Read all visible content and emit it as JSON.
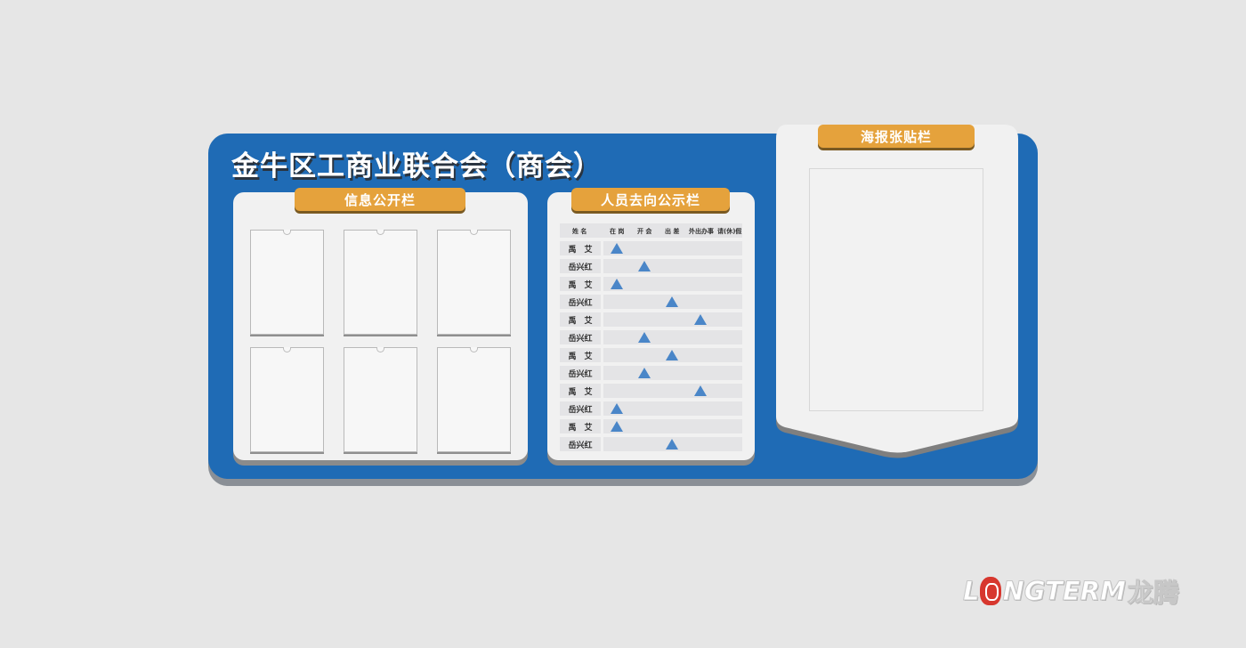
{
  "board": {
    "title": "金牛区工商业联合会（商会）",
    "colors": {
      "board": "#1f6bb5",
      "tab": "#e5a23c",
      "panel": "#f1f1f1",
      "marker": "#4a86c8",
      "background": "#e6e6e6"
    }
  },
  "info_panel": {
    "label": "信息公开栏"
  },
  "staff_panel": {
    "label": "人员去向公示栏",
    "columns": [
      "姓 名",
      "在 岗",
      "开 会",
      "出 差",
      "外出办事",
      "请(休)假"
    ],
    "rows": [
      {
        "name": "禹　艾",
        "status_index": 0
      },
      {
        "name": "岳兴红",
        "status_index": 1
      },
      {
        "name": "禹　艾",
        "status_index": 0
      },
      {
        "name": "岳兴红",
        "status_index": 2
      },
      {
        "name": "禹　艾",
        "status_index": 3
      },
      {
        "name": "岳兴红",
        "status_index": 1
      },
      {
        "name": "禹　艾",
        "status_index": 2
      },
      {
        "name": "岳兴红",
        "status_index": 1
      },
      {
        "name": "禹　艾",
        "status_index": 3
      },
      {
        "name": "岳兴红",
        "status_index": 0
      },
      {
        "name": "禹　艾",
        "status_index": 0
      },
      {
        "name": "岳兴红",
        "status_index": 2
      }
    ]
  },
  "poster_panel": {
    "label": "海报张贴栏"
  },
  "logo": {
    "text_before": "L",
    "text_after": "NGTERM",
    "text_cn": "龙腾",
    "mark_icon": "seal-icon"
  }
}
